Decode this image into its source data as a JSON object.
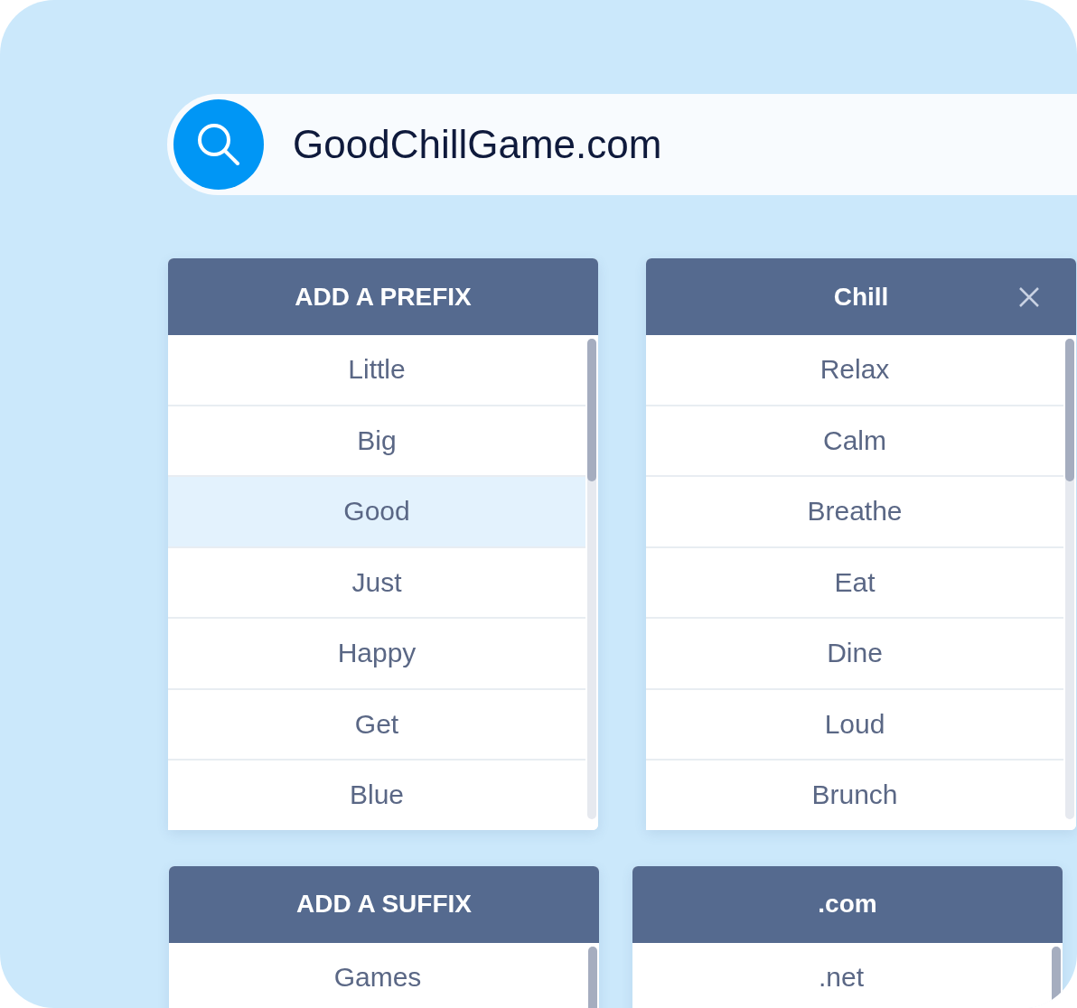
{
  "search": {
    "value": "GoodChillGame.com"
  },
  "panel_rows": [
    [
      {
        "title": "ADD A PREFIX",
        "closable": false,
        "items": [
          {
            "label": "Little",
            "selected": false
          },
          {
            "label": "Big",
            "selected": false
          },
          {
            "label": "Good",
            "selected": true
          },
          {
            "label": "Just",
            "selected": false
          },
          {
            "label": "Happy",
            "selected": false
          },
          {
            "label": "Get",
            "selected": false
          },
          {
            "label": "Blue",
            "selected": false
          }
        ]
      },
      {
        "title": "Chill",
        "closable": true,
        "items": [
          {
            "label": "Relax",
            "selected": false
          },
          {
            "label": "Calm",
            "selected": false
          },
          {
            "label": "Breathe",
            "selected": false
          },
          {
            "label": "Eat",
            "selected": false
          },
          {
            "label": "Dine",
            "selected": false
          },
          {
            "label": "Loud",
            "selected": false
          },
          {
            "label": "Brunch",
            "selected": false
          }
        ]
      }
    ],
    [
      {
        "title": "ADD A SUFFIX",
        "closable": false,
        "items": [
          {
            "label": "Games",
            "selected": false
          }
        ]
      },
      {
        "title": ".com",
        "closable": false,
        "items": [
          {
            "label": ".net",
            "selected": false
          }
        ]
      }
    ]
  ]
}
